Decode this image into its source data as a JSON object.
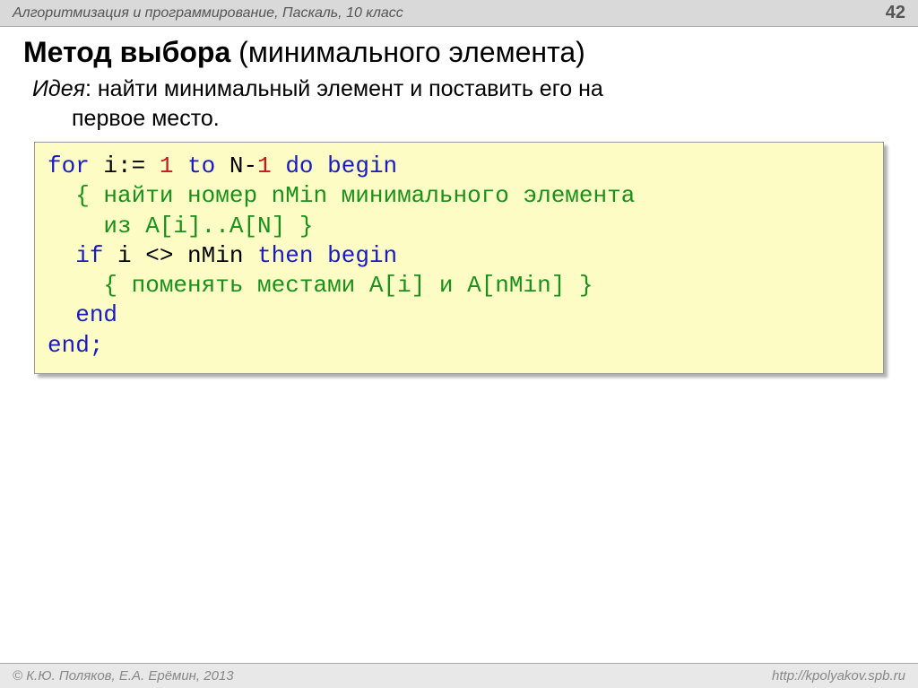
{
  "header": {
    "title": "Алгоритмизация и программирование, Паскаль, 10 класс",
    "page": "42"
  },
  "title": {
    "bold": "Метод выбора",
    "rest": " (минимального элемента)"
  },
  "idea": {
    "label": "Идея",
    "text1": ": найти минимальный элемент и поставить его на",
    "text2": "первое место."
  },
  "code": {
    "kw_for": "for",
    "i_assign": " i:=",
    "num1": " 1",
    "sp": " ",
    "kw_to": "to",
    "n_minus": " N-",
    "one": "1",
    "kw_do": "do",
    "kw_begin": "begin",
    "comment1a": "{ найти номер nMin минимального элемента",
    "comment1b": "из A[i]..A[N] }",
    "kw_if": "if",
    "i_neq": " i <> nMin ",
    "kw_then": "then",
    "comment2": "{ поменять местами A[i] и A[nMin] }",
    "kw_end": "end",
    "end_semi": "end;"
  },
  "footer": {
    "left": "© К.Ю. Поляков, Е.А. Ерёмин, 2013",
    "right": "http://kpolyakov.spb.ru"
  }
}
